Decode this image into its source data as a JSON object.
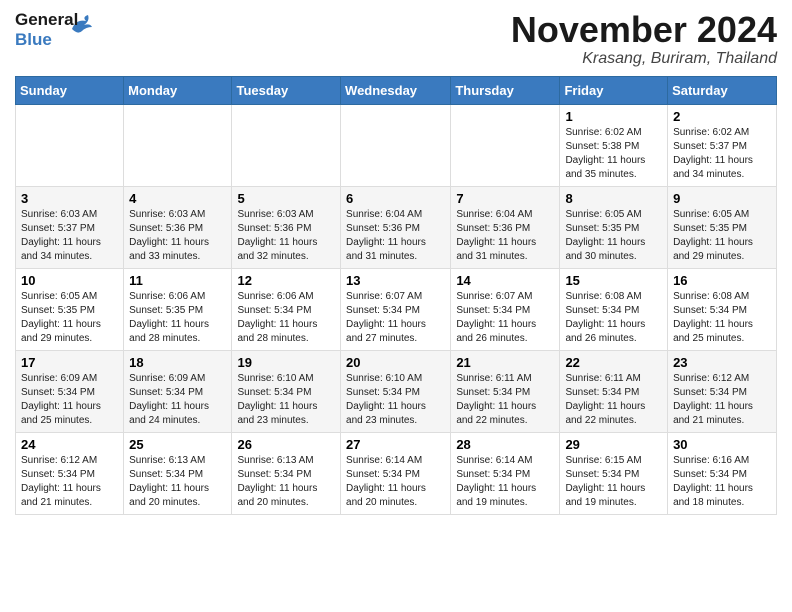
{
  "logo": {
    "line1": "General",
    "line2": "Blue"
  },
  "header": {
    "month": "November 2024",
    "location": "Krasang, Buriram, Thailand"
  },
  "weekdays": [
    "Sunday",
    "Monday",
    "Tuesday",
    "Wednesday",
    "Thursday",
    "Friday",
    "Saturday"
  ],
  "weeks": [
    [
      {
        "day": "",
        "info": ""
      },
      {
        "day": "",
        "info": ""
      },
      {
        "day": "",
        "info": ""
      },
      {
        "day": "",
        "info": ""
      },
      {
        "day": "",
        "info": ""
      },
      {
        "day": "1",
        "info": "Sunrise: 6:02 AM\nSunset: 5:38 PM\nDaylight: 11 hours\nand 35 minutes."
      },
      {
        "day": "2",
        "info": "Sunrise: 6:02 AM\nSunset: 5:37 PM\nDaylight: 11 hours\nand 34 minutes."
      }
    ],
    [
      {
        "day": "3",
        "info": "Sunrise: 6:03 AM\nSunset: 5:37 PM\nDaylight: 11 hours\nand 34 minutes."
      },
      {
        "day": "4",
        "info": "Sunrise: 6:03 AM\nSunset: 5:36 PM\nDaylight: 11 hours\nand 33 minutes."
      },
      {
        "day": "5",
        "info": "Sunrise: 6:03 AM\nSunset: 5:36 PM\nDaylight: 11 hours\nand 32 minutes."
      },
      {
        "day": "6",
        "info": "Sunrise: 6:04 AM\nSunset: 5:36 PM\nDaylight: 11 hours\nand 31 minutes."
      },
      {
        "day": "7",
        "info": "Sunrise: 6:04 AM\nSunset: 5:36 PM\nDaylight: 11 hours\nand 31 minutes."
      },
      {
        "day": "8",
        "info": "Sunrise: 6:05 AM\nSunset: 5:35 PM\nDaylight: 11 hours\nand 30 minutes."
      },
      {
        "day": "9",
        "info": "Sunrise: 6:05 AM\nSunset: 5:35 PM\nDaylight: 11 hours\nand 29 minutes."
      }
    ],
    [
      {
        "day": "10",
        "info": "Sunrise: 6:05 AM\nSunset: 5:35 PM\nDaylight: 11 hours\nand 29 minutes."
      },
      {
        "day": "11",
        "info": "Sunrise: 6:06 AM\nSunset: 5:35 PM\nDaylight: 11 hours\nand 28 minutes."
      },
      {
        "day": "12",
        "info": "Sunrise: 6:06 AM\nSunset: 5:34 PM\nDaylight: 11 hours\nand 28 minutes."
      },
      {
        "day": "13",
        "info": "Sunrise: 6:07 AM\nSunset: 5:34 PM\nDaylight: 11 hours\nand 27 minutes."
      },
      {
        "day": "14",
        "info": "Sunrise: 6:07 AM\nSunset: 5:34 PM\nDaylight: 11 hours\nand 26 minutes."
      },
      {
        "day": "15",
        "info": "Sunrise: 6:08 AM\nSunset: 5:34 PM\nDaylight: 11 hours\nand 26 minutes."
      },
      {
        "day": "16",
        "info": "Sunrise: 6:08 AM\nSunset: 5:34 PM\nDaylight: 11 hours\nand 25 minutes."
      }
    ],
    [
      {
        "day": "17",
        "info": "Sunrise: 6:09 AM\nSunset: 5:34 PM\nDaylight: 11 hours\nand 25 minutes."
      },
      {
        "day": "18",
        "info": "Sunrise: 6:09 AM\nSunset: 5:34 PM\nDaylight: 11 hours\nand 24 minutes."
      },
      {
        "day": "19",
        "info": "Sunrise: 6:10 AM\nSunset: 5:34 PM\nDaylight: 11 hours\nand 23 minutes."
      },
      {
        "day": "20",
        "info": "Sunrise: 6:10 AM\nSunset: 5:34 PM\nDaylight: 11 hours\nand 23 minutes."
      },
      {
        "day": "21",
        "info": "Sunrise: 6:11 AM\nSunset: 5:34 PM\nDaylight: 11 hours\nand 22 minutes."
      },
      {
        "day": "22",
        "info": "Sunrise: 6:11 AM\nSunset: 5:34 PM\nDaylight: 11 hours\nand 22 minutes."
      },
      {
        "day": "23",
        "info": "Sunrise: 6:12 AM\nSunset: 5:34 PM\nDaylight: 11 hours\nand 21 minutes."
      }
    ],
    [
      {
        "day": "24",
        "info": "Sunrise: 6:12 AM\nSunset: 5:34 PM\nDaylight: 11 hours\nand 21 minutes."
      },
      {
        "day": "25",
        "info": "Sunrise: 6:13 AM\nSunset: 5:34 PM\nDaylight: 11 hours\nand 20 minutes."
      },
      {
        "day": "26",
        "info": "Sunrise: 6:13 AM\nSunset: 5:34 PM\nDaylight: 11 hours\nand 20 minutes."
      },
      {
        "day": "27",
        "info": "Sunrise: 6:14 AM\nSunset: 5:34 PM\nDaylight: 11 hours\nand 20 minutes."
      },
      {
        "day": "28",
        "info": "Sunrise: 6:14 AM\nSunset: 5:34 PM\nDaylight: 11 hours\nand 19 minutes."
      },
      {
        "day": "29",
        "info": "Sunrise: 6:15 AM\nSunset: 5:34 PM\nDaylight: 11 hours\nand 19 minutes."
      },
      {
        "day": "30",
        "info": "Sunrise: 6:16 AM\nSunset: 5:34 PM\nDaylight: 11 hours\nand 18 minutes."
      }
    ]
  ]
}
